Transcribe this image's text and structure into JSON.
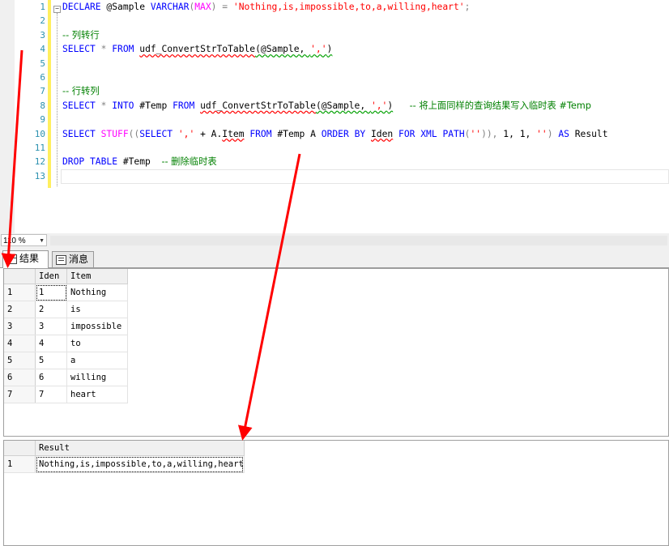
{
  "editor": {
    "line_numbers": [
      "1",
      "2",
      "3",
      "4",
      "5",
      "6",
      "7",
      "8",
      "9",
      "10",
      "11",
      "12",
      "13"
    ],
    "fold_symbol": "−",
    "lines": [
      [
        {
          "t": "DECLARE",
          "c": "kw"
        },
        {
          "t": " @Sample ",
          "c": ""
        },
        {
          "t": "VARCHAR",
          "c": "kw"
        },
        {
          "t": "(",
          "c": "op"
        },
        {
          "t": "MAX",
          "c": "fn"
        },
        {
          "t": ")",
          "c": "op"
        },
        {
          "t": " ",
          "c": ""
        },
        {
          "t": "=",
          "c": "op"
        },
        {
          "t": " ",
          "c": ""
        },
        {
          "t": "'Nothing,is,impossible,to,a,willing,heart'",
          "c": "str"
        },
        {
          "t": ";",
          "c": "op"
        }
      ],
      [],
      [
        {
          "t": "-- 列转行",
          "c": "cm"
        }
      ],
      [
        {
          "t": "SELECT",
          "c": "kw"
        },
        {
          "t": " ",
          "c": ""
        },
        {
          "t": "*",
          "c": "op"
        },
        {
          "t": " ",
          "c": ""
        },
        {
          "t": "FROM",
          "c": "kw"
        },
        {
          "t": " ",
          "c": ""
        },
        {
          "t": "udf_ConvertStrToTable",
          "c": "squig"
        },
        {
          "t": "(@Sample, ",
          "c": "squig-g"
        },
        {
          "t": "','",
          "c": "str squig-g"
        },
        {
          "t": ")",
          "c": "squig-g"
        }
      ],
      [],
      [],
      [
        {
          "t": "-- 行转列",
          "c": "cm"
        }
      ],
      [
        {
          "t": "SELECT",
          "c": "kw"
        },
        {
          "t": " ",
          "c": ""
        },
        {
          "t": "*",
          "c": "op"
        },
        {
          "t": " ",
          "c": ""
        },
        {
          "t": "INTO",
          "c": "kw"
        },
        {
          "t": " #Temp ",
          "c": ""
        },
        {
          "t": "FROM",
          "c": "kw"
        },
        {
          "t": " ",
          "c": ""
        },
        {
          "t": "udf_ConvertStrToTable",
          "c": "squig"
        },
        {
          "t": "(@Sample, ",
          "c": "squig-g"
        },
        {
          "t": "','",
          "c": "str squig-g"
        },
        {
          "t": ")",
          "c": "squig-g"
        },
        {
          "t": "   ",
          "c": ""
        },
        {
          "t": "-- 将上面同样的查询结果写入临时表 #Temp",
          "c": "cm"
        }
      ],
      [],
      [
        {
          "t": "SELECT",
          "c": "kw"
        },
        {
          "t": " ",
          "c": ""
        },
        {
          "t": "STUFF",
          "c": "fn"
        },
        {
          "t": "((",
          "c": "op"
        },
        {
          "t": "SELECT",
          "c": "kw"
        },
        {
          "t": " ",
          "c": ""
        },
        {
          "t": "','",
          "c": "str"
        },
        {
          "t": " + A.",
          "c": ""
        },
        {
          "t": "Item",
          "c": "squig"
        },
        {
          "t": " ",
          "c": ""
        },
        {
          "t": "FROM",
          "c": "kw"
        },
        {
          "t": " #Temp A ",
          "c": ""
        },
        {
          "t": "ORDER BY",
          "c": "kw"
        },
        {
          "t": " ",
          "c": ""
        },
        {
          "t": "Iden",
          "c": "squig"
        },
        {
          "t": " ",
          "c": ""
        },
        {
          "t": "FOR XML PATH",
          "c": "kw"
        },
        {
          "t": "(",
          "c": "op"
        },
        {
          "t": "''",
          "c": "str"
        },
        {
          "t": ")),",
          "c": "op"
        },
        {
          "t": " 1, 1, ",
          "c": ""
        },
        {
          "t": "''",
          "c": "str"
        },
        {
          "t": ") ",
          "c": "op"
        },
        {
          "t": "AS",
          "c": "kw"
        },
        {
          "t": " Result",
          "c": ""
        }
      ],
      [],
      [
        {
          "t": "DROP TABLE",
          "c": "kw"
        },
        {
          "t": " #Temp  ",
          "c": ""
        },
        {
          "t": "-- 删除临时表",
          "c": "cm"
        }
      ],
      []
    ]
  },
  "zoom": {
    "value": "110 %"
  },
  "tabs": {
    "results": "结果",
    "messages": "消息"
  },
  "grid1": {
    "headers": [
      "Iden",
      "Item"
    ],
    "rows": [
      {
        "n": "1",
        "iden": "1",
        "item": "Nothing"
      },
      {
        "n": "2",
        "iden": "2",
        "item": "is"
      },
      {
        "n": "3",
        "iden": "3",
        "item": "impossible"
      },
      {
        "n": "4",
        "iden": "4",
        "item": "to"
      },
      {
        "n": "5",
        "iden": "5",
        "item": "a"
      },
      {
        "n": "6",
        "iden": "6",
        "item": "willing"
      },
      {
        "n": "7",
        "iden": "7",
        "item": "heart"
      }
    ]
  },
  "grid2": {
    "headers": [
      "Result"
    ],
    "rows": [
      {
        "n": "1",
        "result": "Nothing,is,impossible,to,a,willing,heart"
      }
    ]
  },
  "annotation": {
    "arrow_color": "#ff0000"
  }
}
